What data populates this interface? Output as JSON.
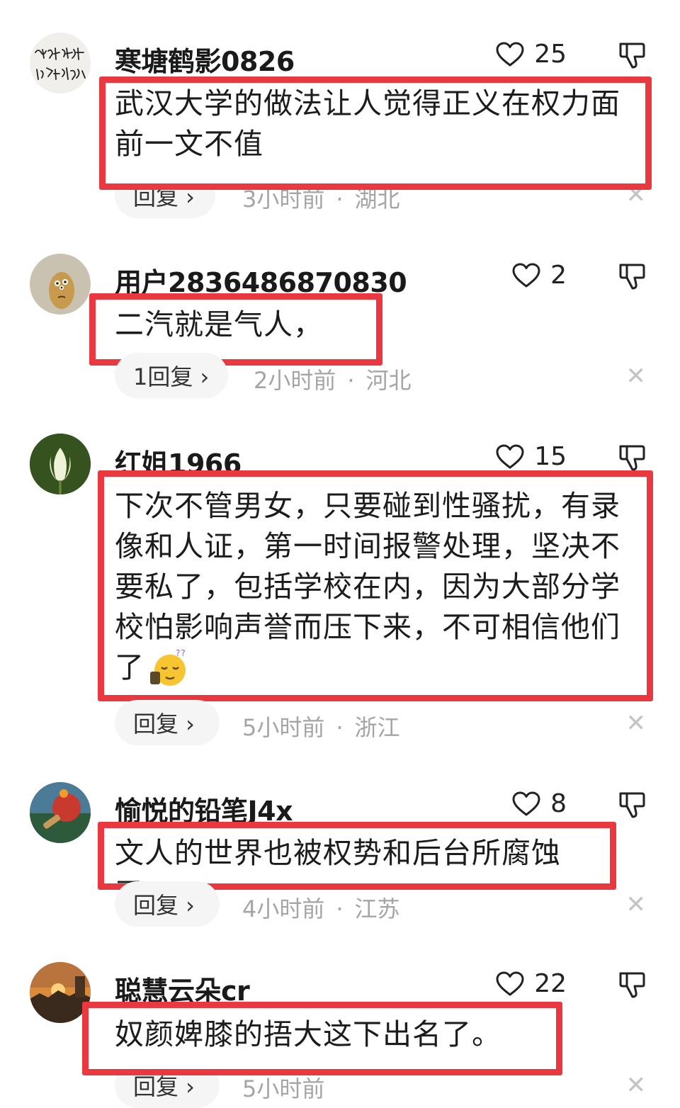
{
  "comments": [
    {
      "username": "寒塘鹤影0826",
      "likes": "25",
      "lines": [
        "武汉大学的做法让人觉得正义在权力面",
        "前一文不值"
      ],
      "reply": "回复 ›",
      "time": "3小时前",
      "location": "湖北"
    },
    {
      "username": "用户2836486870830",
      "likes": "2",
      "lines": [
        "二汽就是气人，"
      ],
      "reply": "1回复 ›",
      "time": "2小时前",
      "location": "河北"
    },
    {
      "username": "红姐1966",
      "likes": "15",
      "lines": [
        "下次不管男女，只要碰到性骚扰，有录",
        "像和人证，第一时间报警处理，坚决不",
        "要私了，包括学校在内，因为大部分学",
        "校怕影响声誉而压下来，不可相信他们",
        "了"
      ],
      "reply": "回复 ›",
      "time": "5小时前",
      "location": "浙江"
    },
    {
      "username": "愉悦的铅笔J4x",
      "likes": "8",
      "lines": [
        "文人的世界也被权势和后台所腐蚀了。"
      ],
      "reply": "回复 ›",
      "time": "4小时前",
      "location": "江苏"
    },
    {
      "username": "聪慧云朵cr",
      "likes": "22",
      "lines": [
        "奴颜婢膝的捂大这下出名了。"
      ],
      "reply": "回复 ›",
      "time": "5小时前",
      "location": ""
    }
  ],
  "avatar1_calligraphy": "愿你出走半生 归来仍是少",
  "icons": {
    "like": "heart-outline-icon",
    "dislike": "thumbs-down-icon",
    "close": "close-icon",
    "emoji": "sleepy-face-emoji-icon"
  },
  "colors": {
    "highlight": "#e9383f",
    "meta_text": "#a5a5a5",
    "pill_bg": "#f5f5f5"
  }
}
